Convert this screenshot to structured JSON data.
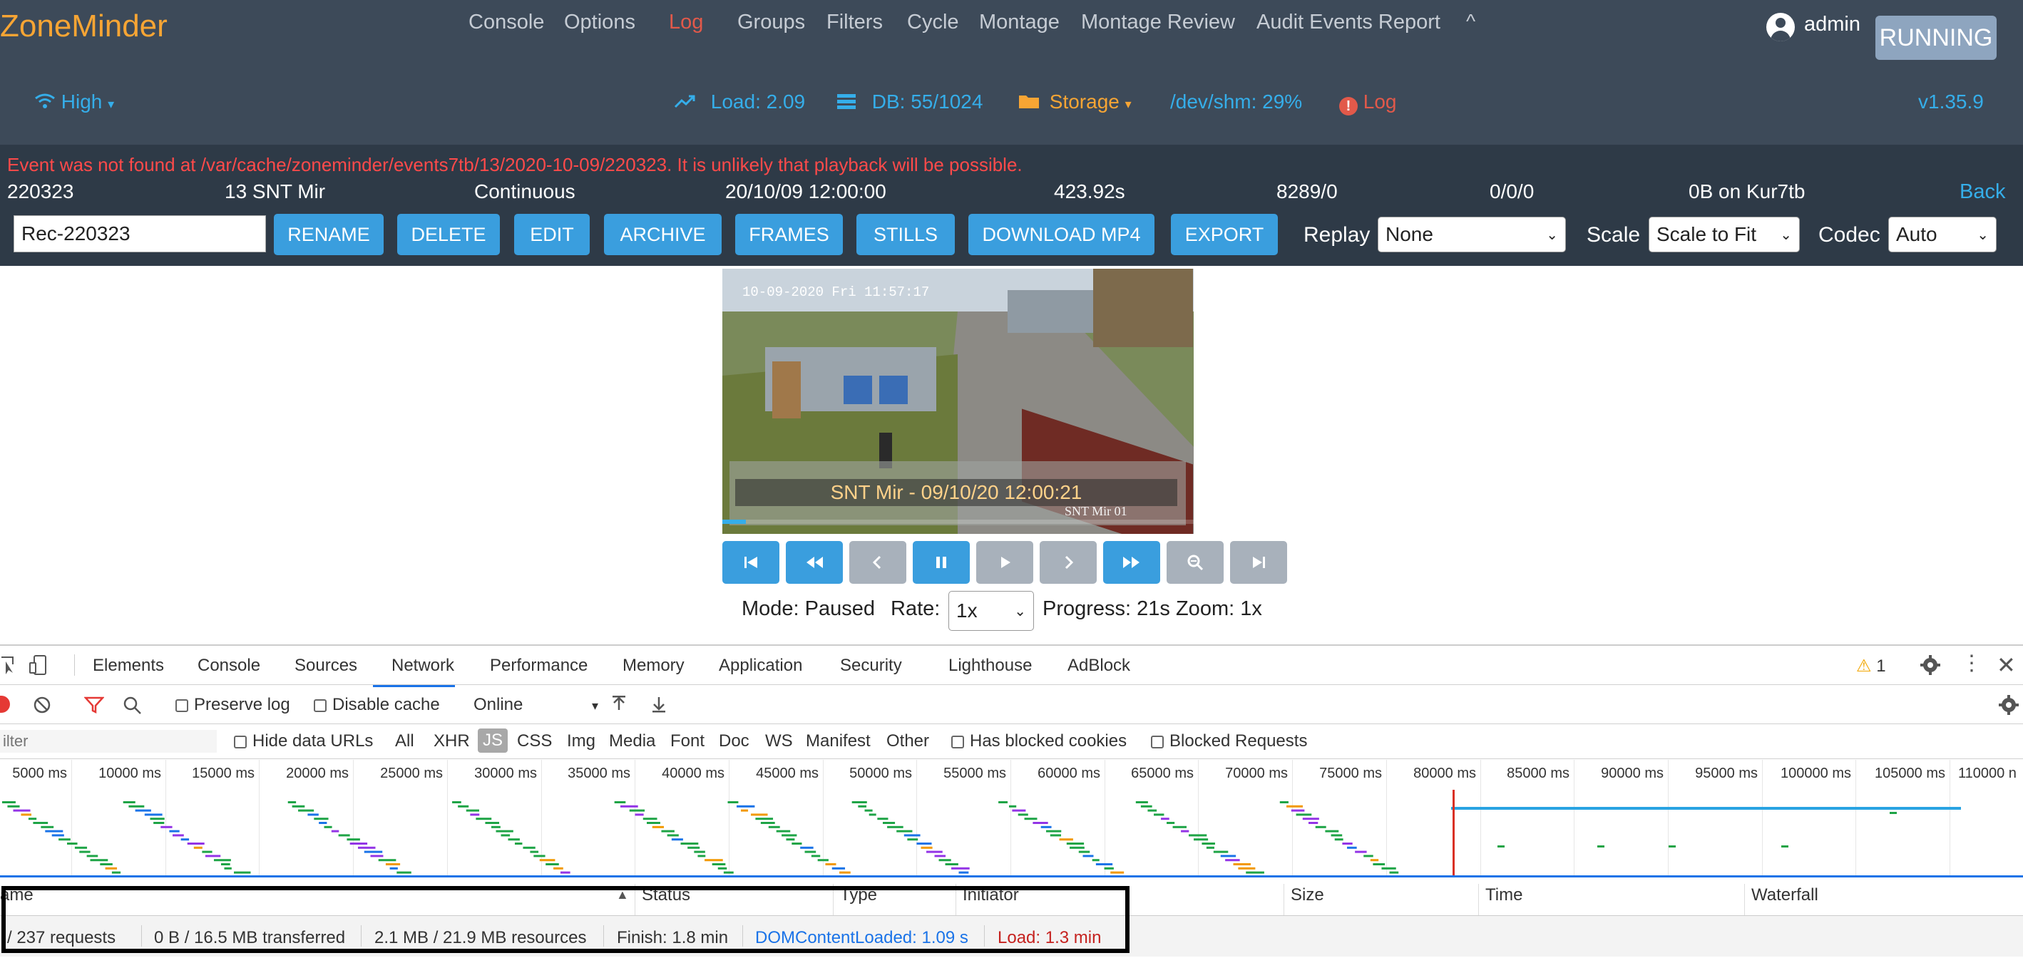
{
  "header": {
    "brand": "ZoneMinder",
    "nav": [
      "Console",
      "Options",
      "Log",
      "Groups",
      "Filters",
      "Cycle",
      "Montage",
      "Montage Review",
      "Audit Events Report"
    ],
    "active_nav": "Log",
    "collapse_caret": "^",
    "user": "admin",
    "status": "RUNNING",
    "bandwidth": "High",
    "load": "Load: 2.09",
    "db": "DB: 55/1024",
    "storage": "Storage",
    "shm": "/dev/shm: 29%",
    "log": "Log",
    "version": "v1.35.9"
  },
  "event": {
    "error": "Event was not found at /var/cache/zoneminder/events7tb/13/2020-10-09/220323. It is unlikely that playback will be possible.",
    "id": "220323",
    "monitor": "13 SNT Mir",
    "cause": "Continuous",
    "start": "20/10/09 12:00:00",
    "duration": "423.92s",
    "frames": "8289/0",
    "score": "0/0/0",
    "storage": "0B on Kur7tb",
    "back": "Back",
    "name": "Rec-220323",
    "buttons": [
      "RENAME",
      "DELETE",
      "EDIT",
      "ARCHIVE",
      "FRAMES",
      "STILLS",
      "DOWNLOAD MP4",
      "EXPORT"
    ],
    "replay_label": "Replay",
    "replay_value": "None",
    "scale_label": "Scale",
    "scale_value": "Scale to Fit",
    "codec_label": "Codec",
    "codec_value": "Auto"
  },
  "video": {
    "timestamp": "10-09-2020 Fri 11:57:17",
    "caption": "SNT Mir - 09/10/20 12:00:21",
    "watermark": "SNT Mir 01",
    "progress_fraction": 0.05
  },
  "playback": {
    "mode": "Mode: Paused",
    "rate_label": "Rate:",
    "rate_value": "1x",
    "progress": "Progress: 21s Zoom: 1x",
    "controls": [
      "first-icon",
      "rewind-icon",
      "prev-icon",
      "pause-icon",
      "play-icon",
      "next-icon",
      "fast-forward-icon",
      "zoom-out-icon",
      "last-icon"
    ]
  },
  "devtools": {
    "tabs": [
      "Elements",
      "Console",
      "Sources",
      "Network",
      "Performance",
      "Memory",
      "Application",
      "Security",
      "Lighthouse",
      "AdBlock"
    ],
    "active_tab": "Network",
    "warnings": "1",
    "preserve_log": "Preserve log",
    "disable_cache": "Disable cache",
    "throttle": "Online",
    "filter_placeholder": "ilter",
    "hide_data_urls": "Hide data URLs",
    "types": [
      "All",
      "XHR",
      "JS",
      "CSS",
      "Img",
      "Media",
      "Font",
      "Doc",
      "WS",
      "Manifest",
      "Other"
    ],
    "has_blocked_cookies": "Has blocked cookies",
    "blocked_requests": "Blocked Requests",
    "ticks": [
      "5000 ms",
      "10000 ms",
      "15000 ms",
      "20000 ms",
      "25000 ms",
      "30000 ms",
      "35000 ms",
      "40000 ms",
      "45000 ms",
      "50000 ms",
      "55000 ms",
      "60000 ms",
      "65000 ms",
      "70000 ms",
      "75000 ms",
      "80000 ms",
      "85000 ms",
      "90000 ms",
      "95000 ms",
      "100000 ms",
      "105000 ms",
      "110000 n"
    ],
    "columns": [
      "ame",
      "Status",
      "Type",
      "Initiator",
      "Size",
      "Time",
      "Waterfall"
    ],
    "summary": {
      "requests": "/ 237 requests",
      "transferred": "0 B / 16.5 MB transferred",
      "resources": "2.1 MB / 21.9 MB resources",
      "finish": "Finish: 1.8 min",
      "dcl": "DOMContentLoaded: 1.09 s",
      "load": "Load: 1.3 min"
    }
  },
  "colors": {
    "nav_bg": "#3d4a59",
    "event_bg": "#2e3a47",
    "brand": "#f7a534",
    "accent": "#3a9ede",
    "link": "#35aeea",
    "error": "#ff4a4a",
    "running": "#8ea5bf"
  }
}
